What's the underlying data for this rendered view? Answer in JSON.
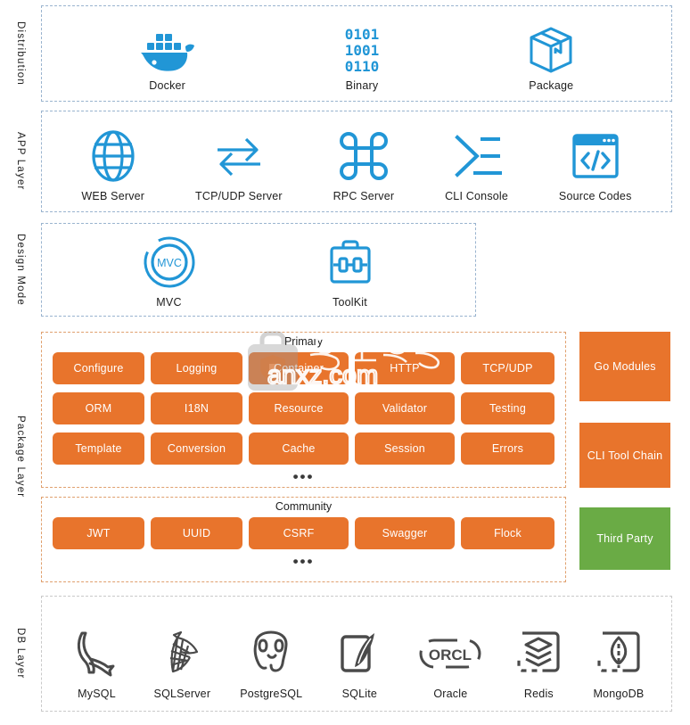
{
  "colors": {
    "blue": "#2196d6",
    "orange": "#e8742c",
    "green": "#6aab45",
    "db_gray": "#4a4a4a",
    "dash_blue": "#9ab4cf",
    "dash_orange": "#e0a06e",
    "dash_gray": "#c9c9c9"
  },
  "layers": {
    "distribution": {
      "label": "Distribution",
      "items": [
        {
          "caption": "Docker",
          "icon": "docker-icon"
        },
        {
          "caption": "Binary",
          "icon": "binary-icon",
          "text": [
            "0101",
            "1001",
            "0110"
          ]
        },
        {
          "caption": "Package",
          "icon": "package-box-icon"
        }
      ]
    },
    "app": {
      "label": "APP Layer",
      "items": [
        {
          "caption": "WEB Server",
          "icon": "globe-icon"
        },
        {
          "caption": "TCP/UDP Server",
          "icon": "exchange-arrows-icon"
        },
        {
          "caption": "RPC Server",
          "icon": "command-icon"
        },
        {
          "caption": "CLI Console",
          "icon": "sigma-icon"
        },
        {
          "caption": "Source Codes",
          "icon": "code-window-icon"
        }
      ]
    },
    "design": {
      "label": "Design Mode",
      "items": [
        {
          "caption": "MVC",
          "icon": "mvc-circle-icon",
          "text": "MVC"
        },
        {
          "caption": "ToolKit",
          "icon": "toolbox-icon"
        }
      ]
    },
    "package": {
      "label": "Package Layer",
      "primary": {
        "title": "Primary",
        "rows": [
          [
            "Configure",
            "Logging",
            "Container",
            "HTTP",
            "TCP/UDP"
          ],
          [
            "ORM",
            "I18N",
            "Resource",
            "Validator",
            "Testing"
          ],
          [
            "Template",
            "Conversion",
            "Cache",
            "Session",
            "Errors"
          ]
        ],
        "more": "•••"
      },
      "community": {
        "title": "Community",
        "rows": [
          [
            "JWT",
            "UUID",
            "CSRF",
            "Swagger",
            "Flock"
          ]
        ],
        "more": "•••"
      },
      "side": [
        {
          "label": "Go Modules",
          "color": "orange"
        },
        {
          "label": "CLI Tool Chain",
          "color": "orange"
        },
        {
          "label": "Third Party",
          "color": "green"
        }
      ]
    },
    "db": {
      "label": "DB Layer",
      "items": [
        {
          "caption": "MySQL",
          "icon": "mysql-dolphin-icon"
        },
        {
          "caption": "SQLServer",
          "icon": "sqlserver-icon"
        },
        {
          "caption": "PostgreSQL",
          "icon": "postgresql-elephant-icon"
        },
        {
          "caption": "SQLite",
          "icon": "sqlite-feather-icon"
        },
        {
          "caption": "Oracle",
          "icon": "oracle-icon",
          "text": "ORCL"
        },
        {
          "caption": "Redis",
          "icon": "redis-stack-icon"
        },
        {
          "caption": "MongoDB",
          "icon": "mongodb-leaf-icon"
        }
      ]
    }
  },
  "watermark": {
    "text": "anxz.com",
    "icon": "bag-shield-watermark-icon"
  }
}
